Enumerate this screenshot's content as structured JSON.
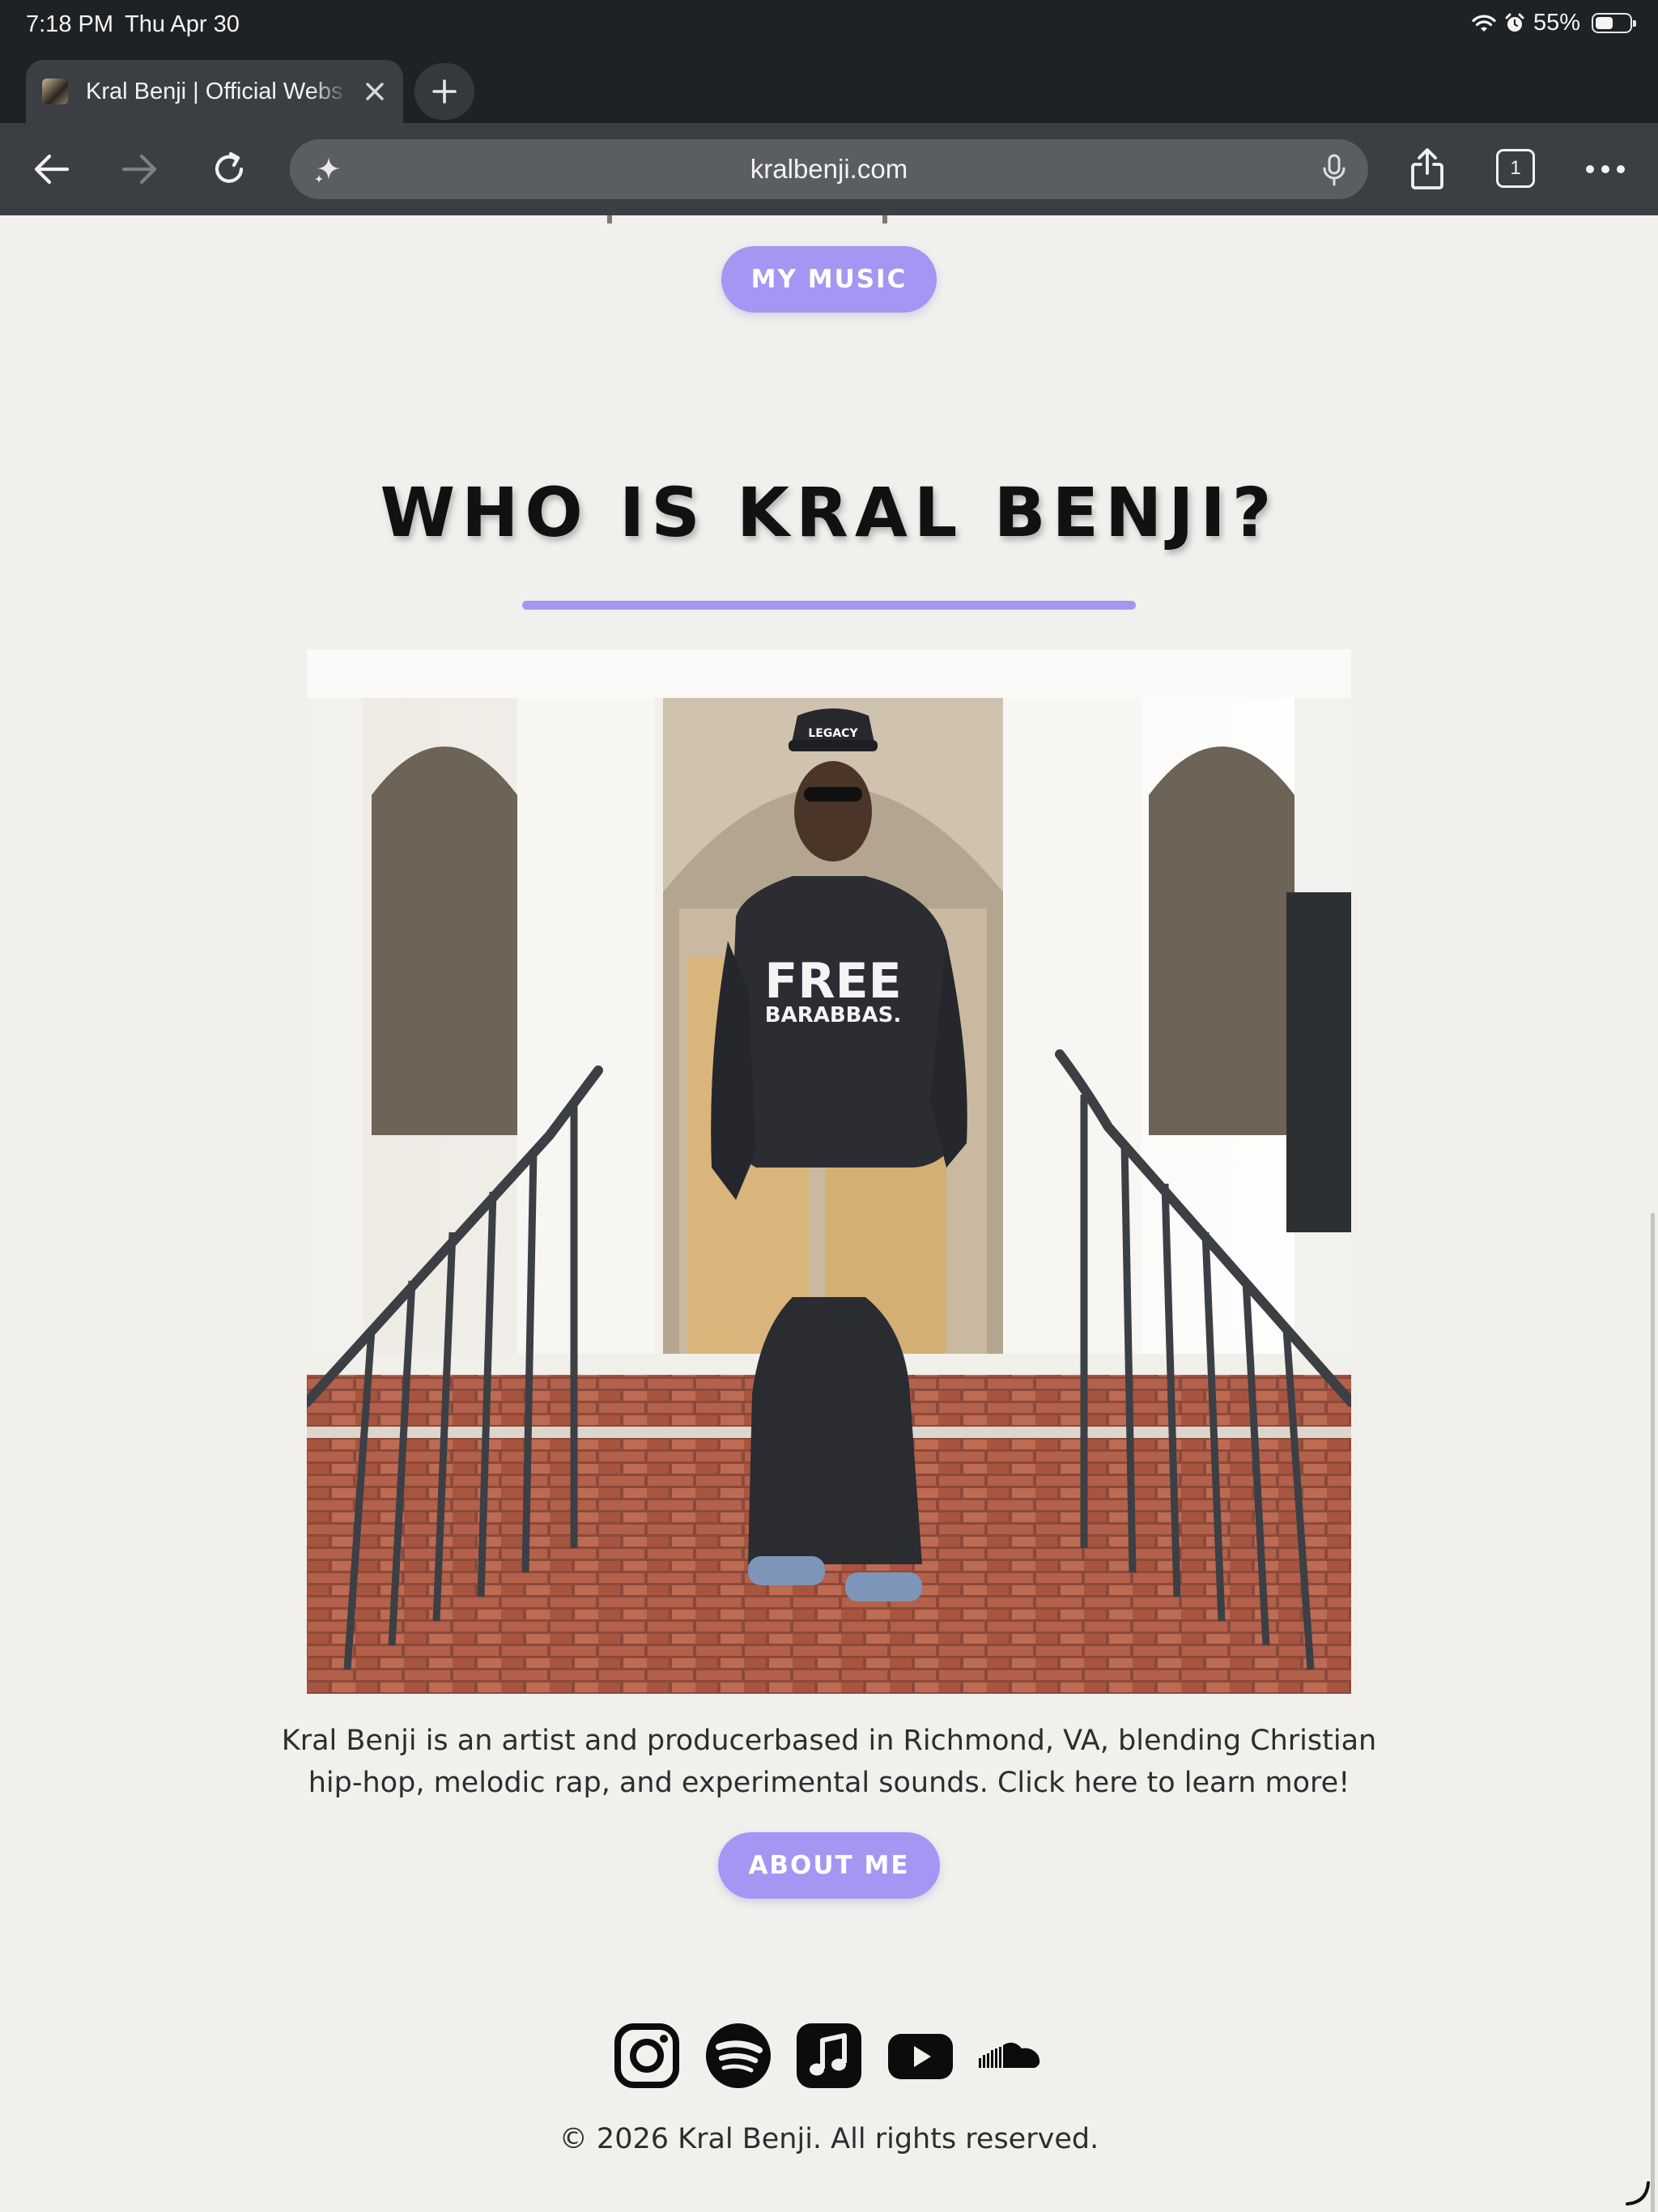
{
  "status_bar": {
    "time": "7:18 PM",
    "date": "Thu Apr 30",
    "battery_percent": "55%",
    "battery_level": 0.55
  },
  "tab": {
    "title": "Kral Benji | Official Webs"
  },
  "toolbar": {
    "url": "kralbenji.com",
    "tab_count": "1"
  },
  "page": {
    "music_button": "MY MUSIC",
    "heading": "WHO IS KRAL BENJI?",
    "bio": "Kral Benji is an artist and producerbased in Richmond, VA, blending Christian hip-hop, melodic rap, and experimental sounds. Click here to learn more!",
    "about_button": "ABOUT ME",
    "photo_hat_text": "LEGACY",
    "photo_hoodie_text": [
      "FREE",
      "BARABBAS."
    ],
    "socials": [
      "instagram-icon",
      "spotify-icon",
      "apple-music-icon",
      "youtube-icon",
      "soundcloud-icon"
    ],
    "copyright": "© 2026 Kral Benji. All rights reserved."
  },
  "colors": {
    "accent": "#a496f2",
    "background": "#f1f0ed",
    "chrome": "#1f2225",
    "toolbar": "#3b3f43"
  }
}
